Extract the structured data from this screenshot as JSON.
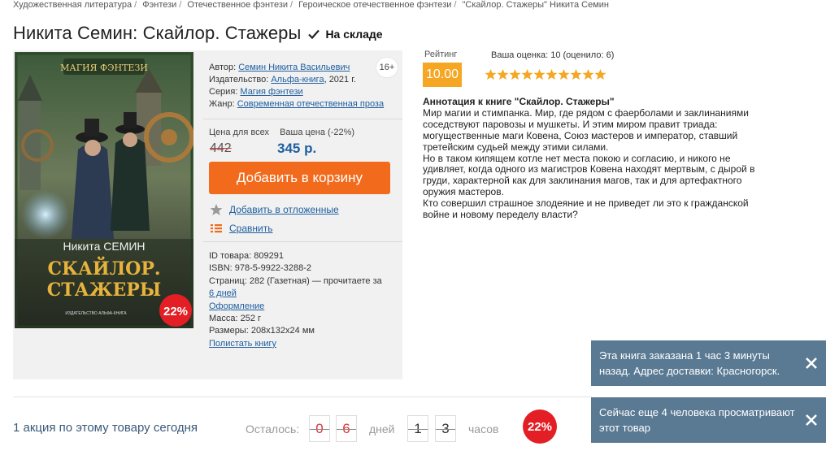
{
  "breadcrumb": [
    "Художественная литература",
    "Фэнтези",
    "Отечественное фэнтези",
    "Героическое отечественное фэнтези",
    "\"Скайлор. Стажеры\" Никита Семин"
  ],
  "product": {
    "title": "Никита Семин: Скайлор. Стажеры",
    "stock": "На складе",
    "age": "16+",
    "cover": {
      "series_logo": "МАГИЯ ФЭНТЕЗИ",
      "author": "Никита СЕМИН",
      "title_line1": "СКАЙЛОР.",
      "title_line2": "СТАЖЕРЫ",
      "publisher": "ИЗДАТЕЛЬСТВО АЛЬФА-КНИГА",
      "discount": "22%"
    },
    "details": {
      "author_label": "Автор:",
      "author": "Семин Никита Васильевич",
      "publisher_label": "Издательство:",
      "publisher": "Альфа-книга",
      "year": ", 2021 г.",
      "series_label": "Серия:",
      "series": "Магия фэнтези",
      "genre_label": "Жанр:",
      "genre": "Современная отечественная проза"
    },
    "price": {
      "all_label": "Цена для всех",
      "your_label": "Ваша цена (-22%)",
      "old": "442",
      "new": "345 р."
    },
    "add_to_cart": "Добавить в корзину",
    "wishlist": "Добавить в отложенные",
    "compare": "Сравнить",
    "specs": {
      "id": "ID товара: 809291",
      "isbn": "ISBN: 978-5-9922-3288-2",
      "pages": "Страниц: 282 (Газетная) — прочитаете за",
      "read_days": "6 дней",
      "design": "Оформление",
      "weight": "Масса: 252 г",
      "size": "Размеры: 208x132x24 мм",
      "browse": "Полистать книгу"
    }
  },
  "rating": {
    "label": "Рейтинг",
    "value": "10.00",
    "your": "Ваша оценка: 10 (оценило: 6)",
    "stars": 10,
    "star_color": "#f5a623"
  },
  "annotation": {
    "heading": "Аннотация к книге \"Скайлор. Стажеры\"",
    "paragraphs": [
      "Мир магии и стимпанка. Мир, где рядом с фаерболами и заклинаниями соседствуют паровозы и мушкеты. И этим миром правит триада: могущественные маги Ковена, Союз мастеров и император, ставший третейским судьей между этими силами.",
      "Но в таком кипящем котле нет места покою и согласию, и никого не удивляет, когда одного из магистров Ковена находят мертвым, с дырой в груди, характерной как для заклинания магов, так и для артефактного оружия мастеров.",
      "Кто совершил страшное злодеяние и не приведет ли это к гражданской войне и новому переделу власти?"
    ]
  },
  "promo": {
    "text": "1 акция по этому товару сегодня",
    "remaining": "Осталось:",
    "days_digits": [
      "0",
      "6"
    ],
    "days_label": "дней",
    "hours_digits": [
      "1",
      "3"
    ],
    "hours_label": "часов",
    "discount": "22%"
  },
  "toasts": [
    "Эта книга заказана 1 час 3 минуты назад. Адрес доставки: Красногорск.",
    "Сейчас еще 4 человека просматривают этот товар"
  ],
  "colors": {
    "accent": "#f26b1d",
    "link": "#1f5fa0",
    "badge": "#e31e24",
    "toast": "#5a7a93"
  }
}
